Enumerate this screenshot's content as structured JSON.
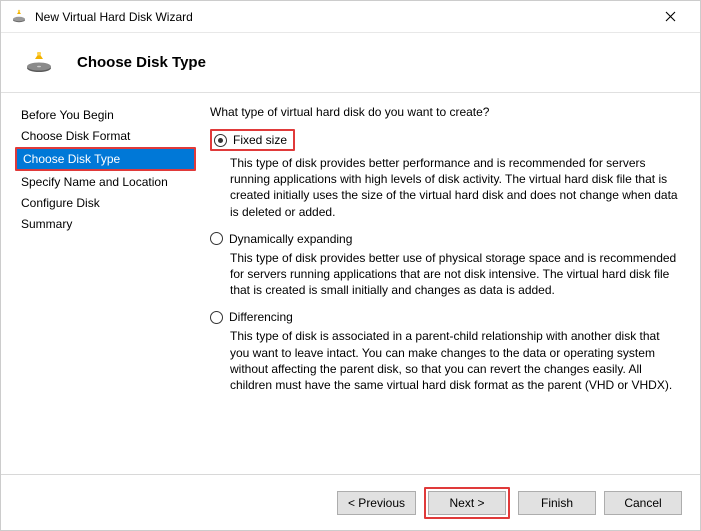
{
  "window": {
    "title": "New Virtual Hard Disk Wizard"
  },
  "header": {
    "title": "Choose Disk Type"
  },
  "sidebar": {
    "items": [
      {
        "label": "Before You Begin",
        "selected": false
      },
      {
        "label": "Choose Disk Format",
        "selected": false
      },
      {
        "label": "Choose Disk Type",
        "selected": true
      },
      {
        "label": "Specify Name and Location",
        "selected": false
      },
      {
        "label": "Configure Disk",
        "selected": false
      },
      {
        "label": "Summary",
        "selected": false
      }
    ]
  },
  "content": {
    "question": "What type of virtual hard disk do you want to create?",
    "options": [
      {
        "label": "Fixed size",
        "checked": true,
        "highlight": true,
        "desc": "This type of disk provides better performance and is recommended for servers running applications with high levels of disk activity. The virtual hard disk file that is created initially uses the size of the virtual hard disk and does not change when data is deleted or added."
      },
      {
        "label": "Dynamically expanding",
        "checked": false,
        "highlight": false,
        "desc": "This type of disk provides better use of physical storage space and is recommended for servers running applications that are not disk intensive. The virtual hard disk file that is created is small initially and changes as data is added."
      },
      {
        "label": "Differencing",
        "checked": false,
        "highlight": false,
        "desc": "This type of disk is associated in a parent-child relationship with another disk that you want to leave intact. You can make changes to the data or operating system without affecting the parent disk, so that you can revert the changes easily. All children must have the same virtual hard disk format as the parent (VHD or VHDX)."
      }
    ]
  },
  "footer": {
    "previous": "< Previous",
    "next": "Next >",
    "finish": "Finish",
    "cancel": "Cancel"
  }
}
